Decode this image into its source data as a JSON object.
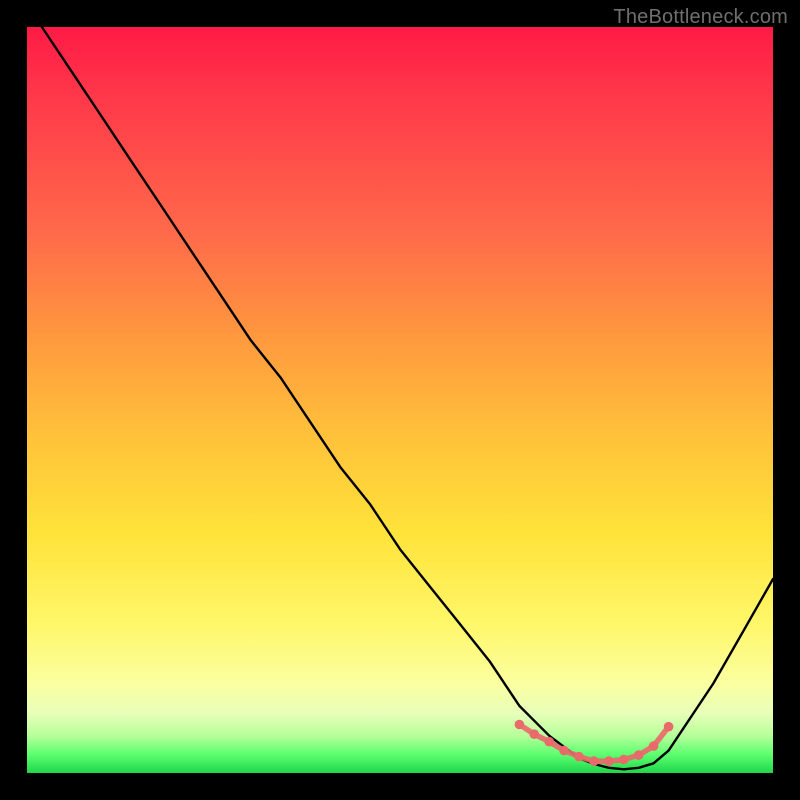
{
  "watermark": "TheBottleneck.com",
  "chart_data": {
    "type": "line",
    "title": "",
    "xlabel": "",
    "ylabel": "",
    "xlim": [
      0,
      100
    ],
    "ylim": [
      0,
      100
    ],
    "series": [
      {
        "name": "curve",
        "x": [
          2,
          6,
          10,
          14,
          18,
          22,
          26,
          30,
          34,
          38,
          42,
          46,
          50,
          54,
          58,
          62,
          66,
          68,
          70,
          72,
          74,
          76,
          78,
          80,
          82,
          84,
          86,
          88,
          92,
          96,
          100
        ],
        "y": [
          100,
          94,
          88,
          82,
          76,
          70,
          64,
          58,
          53,
          47,
          41,
          36,
          30,
          25,
          20,
          15,
          9,
          7,
          5,
          3.5,
          2,
          1.2,
          0.7,
          0.5,
          0.7,
          1.3,
          3,
          6,
          12,
          19,
          26
        ]
      },
      {
        "name": "bottom-markers",
        "x": [
          66,
          68,
          70,
          72,
          74,
          76,
          78,
          80,
          82,
          84,
          86
        ],
        "y": [
          6.5,
          5.2,
          4.2,
          3,
          2.2,
          1.6,
          1.6,
          1.8,
          2.4,
          3.6,
          6.2
        ]
      }
    ],
    "colors": {
      "curve": "#000000",
      "markers": "#e96a6a"
    }
  }
}
